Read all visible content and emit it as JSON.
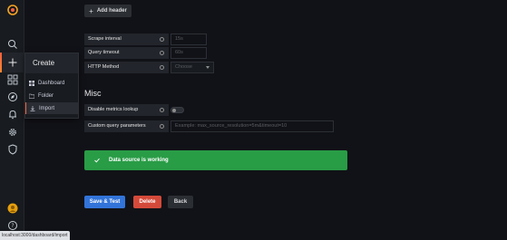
{
  "sidebar": {
    "icons": [
      "search-icon",
      "plus-icon",
      "apps-icon",
      "compass-icon",
      "bell-icon",
      "gear-icon",
      "shield-icon"
    ],
    "avatar": "user-avatar",
    "help": "help-icon"
  },
  "flyout": {
    "title": "Create",
    "items": [
      {
        "label": "Dashboard",
        "icon": "apps-icon"
      },
      {
        "label": "Folder",
        "icon": "folder-icon"
      },
      {
        "label": "Import",
        "icon": "import-icon"
      }
    ]
  },
  "main": {
    "add_header_label": "Add header",
    "fields": {
      "scrape_interval": {
        "label": "Scrape interval",
        "placeholder": "15s"
      },
      "query_timeout": {
        "label": "Query timeout",
        "placeholder": "60s"
      },
      "http_method": {
        "label": "HTTP Method",
        "value": "Choose"
      }
    },
    "misc_title": "Misc",
    "disable_metrics": {
      "label": "Disable metrics lookup",
      "enabled": false
    },
    "custom_query": {
      "label": "Custom query parameters",
      "placeholder": "Example: max_source_resolution=5m&timeout=10"
    },
    "alert_text": "Data source is working",
    "save_label": "Save & Test",
    "delete_label": "Delete",
    "back_label": "Back"
  },
  "status_url": "localhost:3000/dashboard/import",
  "colors": {
    "background": "#111217",
    "sidebar": "#181b1f",
    "success": "#299c46",
    "primary": "#3274d9",
    "danger": "#d44a3a",
    "accent": "#f55f3e"
  }
}
